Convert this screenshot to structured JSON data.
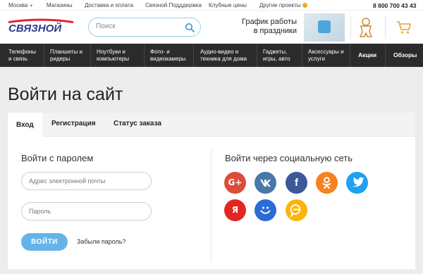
{
  "topbar": {
    "city": "Москва",
    "links": [
      "Магазины",
      "Доставка и оплата",
      "Связной Подддержка",
      "Клубные цены",
      "Другие проекты"
    ],
    "phone": "8 800 700 43 43"
  },
  "header": {
    "logo_text": "СВЯЗНОЙ",
    "search_placeholder": "Поиск",
    "promo_line1": "График работы",
    "promo_line2": "в праздники"
  },
  "nav": {
    "items": [
      "Телефоны\nи связь",
      "Планшеты и\nридеры",
      "Ноутбуки и\nкомпьютеры",
      "Фото- и\nвидеокамеры",
      "Аудио-видео и\nтехника для дома",
      "Гаджеты,\nигры, авто",
      "Аксессуары и\nуслуги",
      "Акции",
      "Обзоры"
    ]
  },
  "page": {
    "title": "Войти на сайт",
    "tabs": [
      "Вход",
      "Регистрация",
      "Статус заказа"
    ],
    "login_heading": "Войти с паролем",
    "email_placeholder": "Адрес электронной почты",
    "password_placeholder": "Пароль",
    "login_button": "ВОЙТИ",
    "forgot_link": "Забыли пароль?",
    "social_heading": "Войти через социальную сеть"
  },
  "social": [
    {
      "name": "google",
      "glyph": "G+",
      "color": "#dd4b39"
    },
    {
      "name": "vk",
      "glyph": "vk",
      "color": "#4a76a8"
    },
    {
      "name": "facebook",
      "glyph": "f",
      "color": "#3b5998"
    },
    {
      "name": "odnoklassniki",
      "glyph": "ok",
      "color": "#f58220"
    },
    {
      "name": "twitter",
      "glyph": "tw",
      "color": "#1da1f2"
    },
    {
      "name": "yandex",
      "glyph": "Я",
      "color": "#e52620"
    },
    {
      "name": "mail-ru",
      "glyph": "mail",
      "color": "#2b6bd6"
    },
    {
      "name": "chat",
      "glyph": "chat",
      "color": "#fcb40c"
    }
  ],
  "colors": {
    "accent": "#64b4e8",
    "nav_bg": "#2b2b2b",
    "logo_blue": "#2a3a8f",
    "logo_red": "#e3232d"
  }
}
